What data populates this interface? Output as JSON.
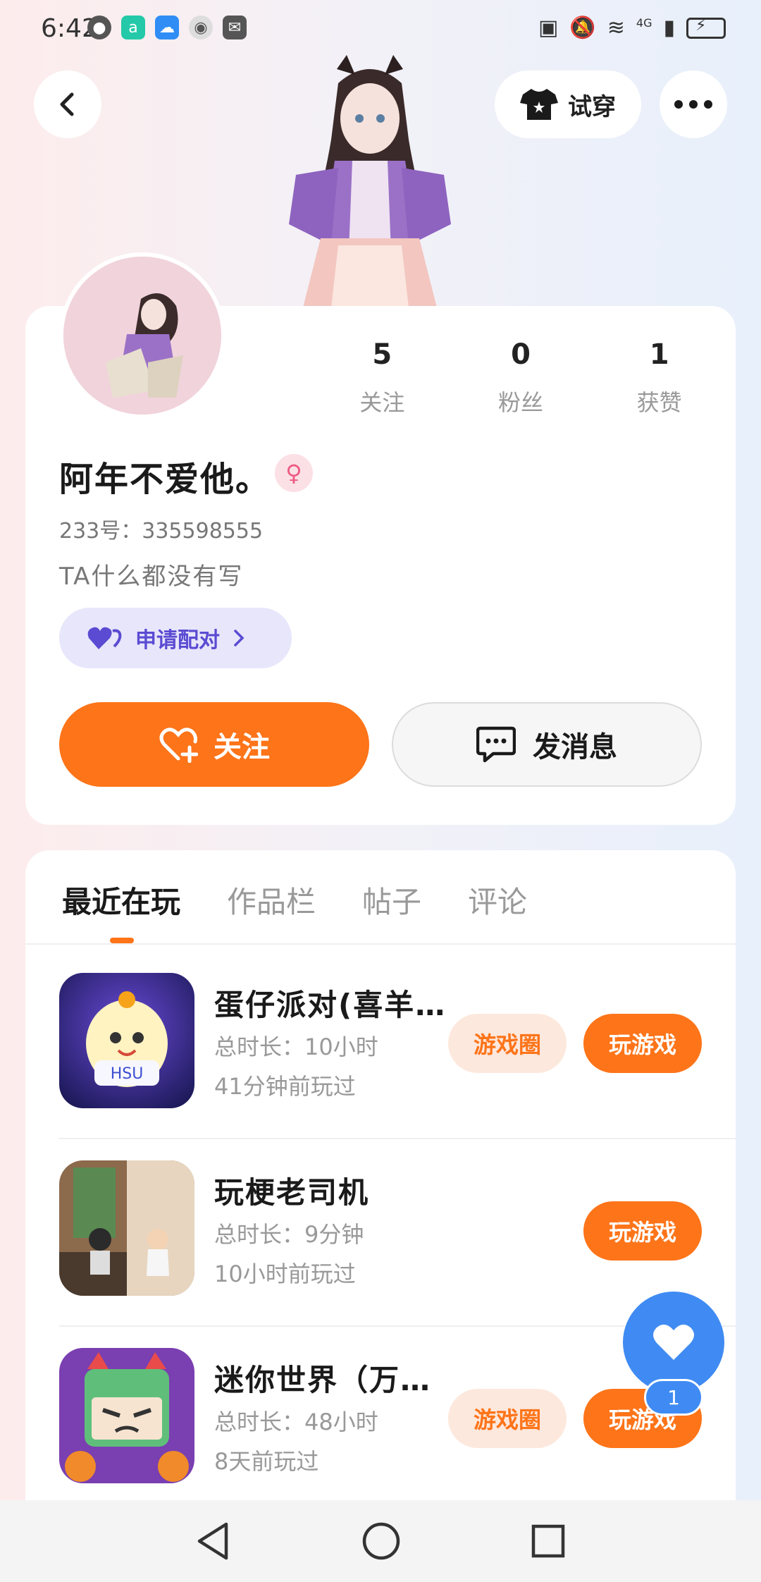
{
  "status_bar": {
    "time": "6:42",
    "network": "4G"
  },
  "header": {
    "try_on_label": "试穿"
  },
  "profile": {
    "username": "阿年不爱他。",
    "gender_symbol": "♀",
    "uid": "233号：335598555",
    "bio": "TA什么都没有写",
    "match_label": "申请配对",
    "stats": [
      {
        "num": "5",
        "label": "关注"
      },
      {
        "num": "0",
        "label": "粉丝"
      },
      {
        "num": "1",
        "label": "获赞"
      }
    ],
    "follow_label": "关注",
    "message_label": "发消息"
  },
  "tabs": [
    {
      "label": "最近在玩"
    },
    {
      "label": "作品栏"
    },
    {
      "label": "帖子"
    },
    {
      "label": "评论"
    }
  ],
  "games": [
    {
      "title": "蛋仔派对(喜羊…",
      "duration": "总时长：10小时",
      "last_played": "41分钟前玩过",
      "circle_label": "游戏圈",
      "play_label": "玩游戏"
    },
    {
      "title": "玩梗老司机",
      "duration": "总时长：9分钟",
      "last_played": "10小时前玩过",
      "play_label": "玩游戏"
    },
    {
      "title": "迷你世界（万…",
      "duration": "总时长：48小时",
      "last_played": "8天前玩过",
      "circle_label": "游戏圈",
      "play_label": "玩游戏"
    }
  ],
  "fab": {
    "badge": "1"
  },
  "colors": {
    "accent": "#fd7419",
    "fab_blue": "#3f8bf3",
    "match_purple": "#5a4bd2"
  }
}
